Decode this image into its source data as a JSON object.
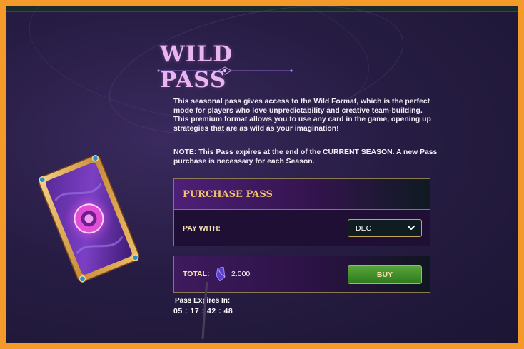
{
  "page": {
    "title": "WILD PASS",
    "description": "This seasonal pass gives access to the Wild Format, which is the perfect mode for players who love unpredictability and creative team-building. This premium format allows you to use any card in the game, opening up strategies that are as wild as your imagination!",
    "note": "NOTE: This Pass expires at the end of the CURRENT SEASON. A new Pass purchase is necessary for each Season."
  },
  "purchase": {
    "header": "PURCHASE PASS",
    "pay_with_label": "PAY WITH:",
    "currency_selected": "DEC",
    "total_label": "TOTAL:",
    "total_value": "2.000",
    "buy_label": "BUY",
    "currency_icon": "purple-gem-icon"
  },
  "expiry": {
    "label": "Pass Expires In:",
    "timer": "05 : 17 : 42 : 48"
  },
  "colors": {
    "border_frame": "#f39a2a",
    "title": "#e9b6f0",
    "header_gold": "#f0c36a",
    "button_green": "#3f8f28",
    "panel_border": "#8a7a52"
  }
}
